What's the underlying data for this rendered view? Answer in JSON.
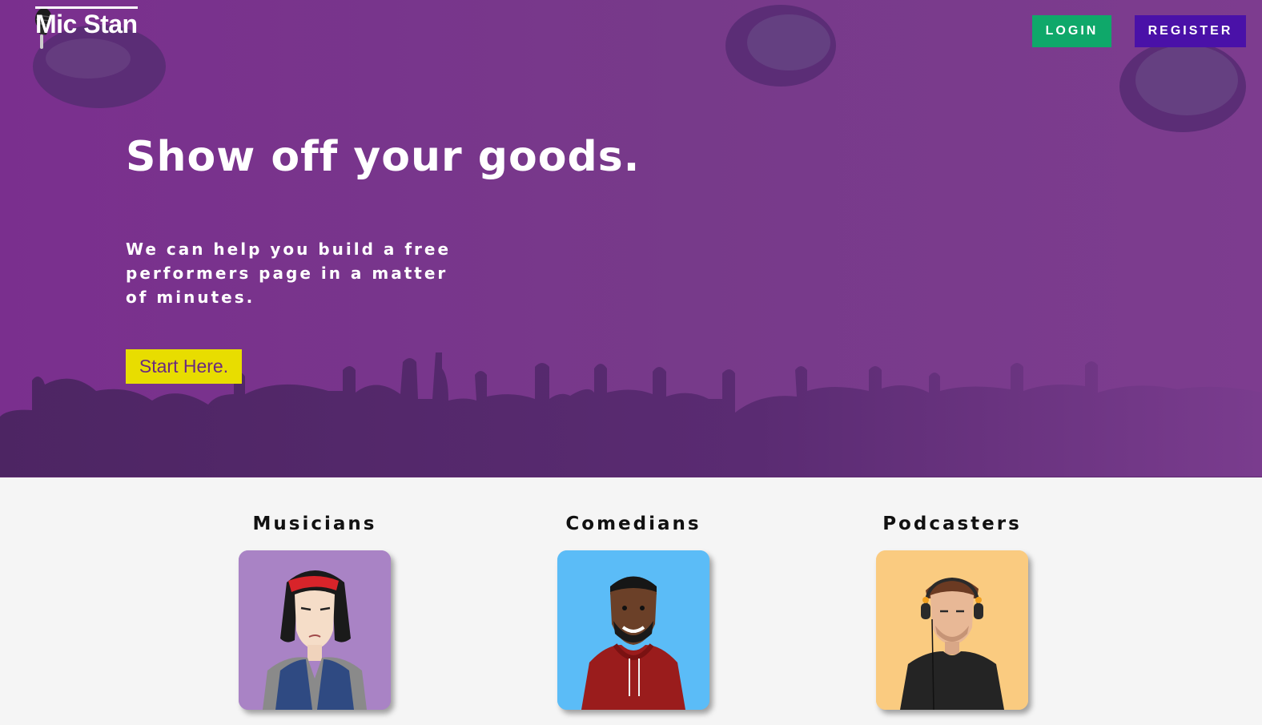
{
  "header": {
    "brand_name": "Mic Stan",
    "login_label": "LOGIN",
    "register_label": "REGISTER"
  },
  "hero": {
    "headline": "Show off your goods.",
    "subhead": "We can help you build a free performers page in a matter of minutes.",
    "cta_label": "Start Here."
  },
  "categories": [
    {
      "title": "Musicians",
      "avatar": "musician-avatar",
      "bg_color": "#a983c5"
    },
    {
      "title": "Comedians",
      "avatar": "comedian-avatar",
      "bg_color": "#5bbcf7"
    },
    {
      "title": "Podcasters",
      "avatar": "podcaster-avatar",
      "bg_color": "#facb80"
    }
  ],
  "colors": {
    "hero_purple": "#773a8a",
    "login_green": "#0fa86a",
    "register_purple": "#4a11a8",
    "cta_yellow": "#e8dd00"
  }
}
